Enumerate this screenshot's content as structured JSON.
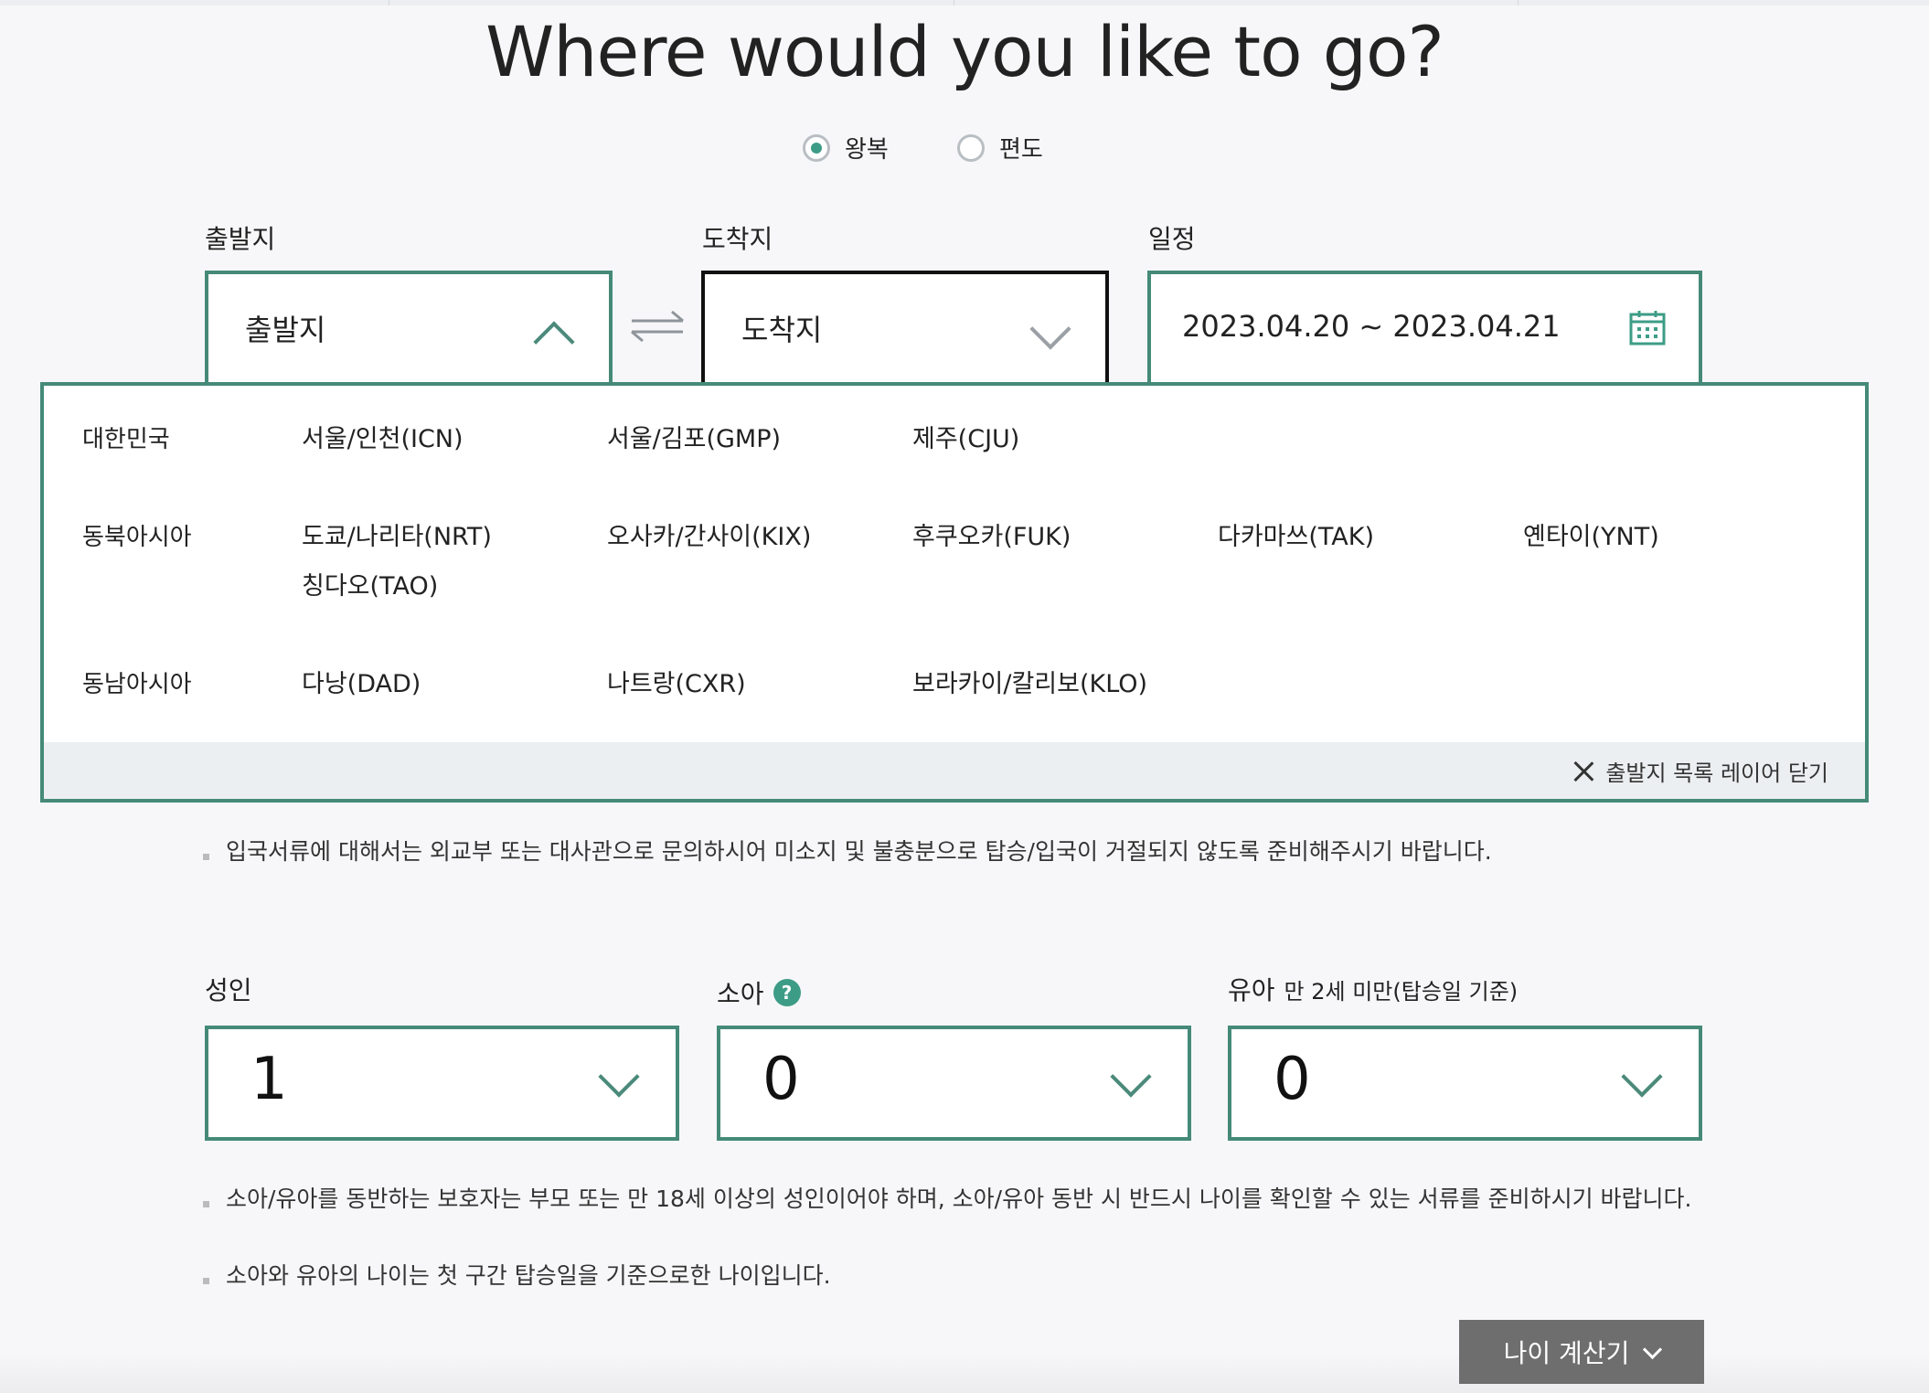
{
  "page": {
    "title": "Where would you like to go?"
  },
  "trip_type": {
    "options": [
      {
        "label": "왕복",
        "selected": true
      },
      {
        "label": "편도",
        "selected": false
      }
    ]
  },
  "fields": {
    "departure": {
      "label": "출발지",
      "value": "출발지"
    },
    "arrival": {
      "label": "도착지",
      "value": "도착지"
    },
    "schedule": {
      "label": "일정",
      "value": "2023.04.20 ~ 2023.04.21"
    }
  },
  "departure_layer": {
    "regions": [
      {
        "name": "대한민국",
        "cities": [
          "서울/인천(ICN)",
          "서울/김포(GMP)",
          "제주(CJU)"
        ]
      },
      {
        "name": "동북아시아",
        "cities": [
          "도쿄/나리타(NRT)",
          "오사카/간사이(KIX)",
          "후쿠오카(FUK)",
          "다카마쓰(TAK)",
          "옌타이(YNT)",
          "칭다오(TAO)"
        ]
      },
      {
        "name": "동남아시아",
        "cities": [
          "다낭(DAD)",
          "나트랑(CXR)",
          "보라카이/칼리보(KLO)"
        ]
      }
    ],
    "close_label": "출발지 목록 레이어 닫기"
  },
  "notice_entry": "입국서류에 대해서는 외교부 또는 대사관으로 문의하시어 미소지 및 불충분으로 탑승/입국이 거절되지 않도록 준비해주시기 바랍니다.",
  "passengers": {
    "adult": {
      "label": "성인",
      "value": "1"
    },
    "child": {
      "label": "소아",
      "help": "?",
      "value": "0"
    },
    "infant": {
      "label": "유아",
      "sub": "만 2세 미만(탑승일 기준)",
      "value": "0"
    }
  },
  "notices_pax": [
    "소아/유아를 동반하는 보호자는 부모 또는 만 18세 이상의 성인이어야 하며, 소아/유아 동반 시 반드시 나이를 확인할 수 있는 서류를 준비하시기 바랍니다.",
    "소아와 유아의 나이는 첫 구간 탑승일을 기준으로한 나이입니다."
  ],
  "age_calculator": {
    "label": "나이 계산기"
  },
  "colors": {
    "accent": "#458a78",
    "radio": "#3d9c86",
    "button": "#6e6e6e"
  }
}
